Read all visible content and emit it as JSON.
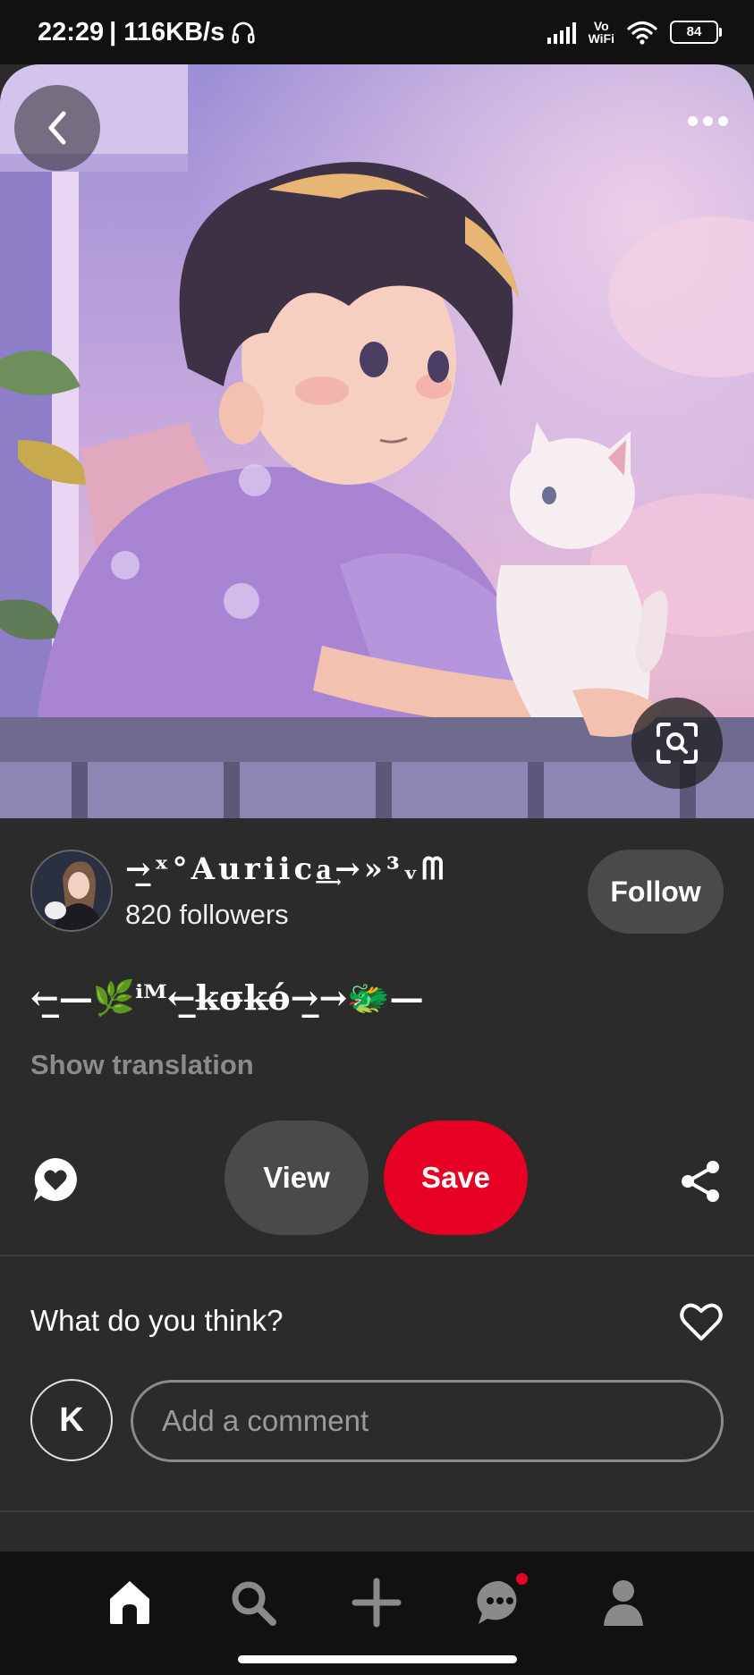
{
  "status_bar": {
    "time": "22:29",
    "net_speed": "| 116KB/s",
    "vowifi_line1": "Vo",
    "vowifi_line2": "WiFi",
    "battery": "84"
  },
  "hero": {
    "back_icon": "chevron-left-icon",
    "more_icon": "more-horizontal-icon",
    "lens_icon": "visual-search-icon"
  },
  "creator": {
    "name": "→̲ˣ°Auriica̲͢→»³ᵥᗰ",
    "followers": "820 followers",
    "follow_label": "Follow"
  },
  "pin": {
    "title": "←̲—🌿ⁱᴹ←̲k̶σ̶k̶ό̶→̲→🐲—",
    "show_translation": "Show translation"
  },
  "actions": {
    "view_label": "View",
    "save_label": "Save",
    "save_color": "#e60023",
    "comment_icon": "comment-heart-icon",
    "share_icon": "share-icon"
  },
  "comments": {
    "prompt": "What do you think?",
    "heart_icon": "heart-outline-icon",
    "user_initial": "K",
    "placeholder": "Add a comment"
  },
  "nav": {
    "items": [
      {
        "name": "home-icon",
        "active": true
      },
      {
        "name": "search-icon",
        "active": false
      },
      {
        "name": "create-plus-icon",
        "active": false
      },
      {
        "name": "messages-icon",
        "active": false,
        "badge": true
      },
      {
        "name": "profile-icon",
        "active": false
      }
    ]
  }
}
